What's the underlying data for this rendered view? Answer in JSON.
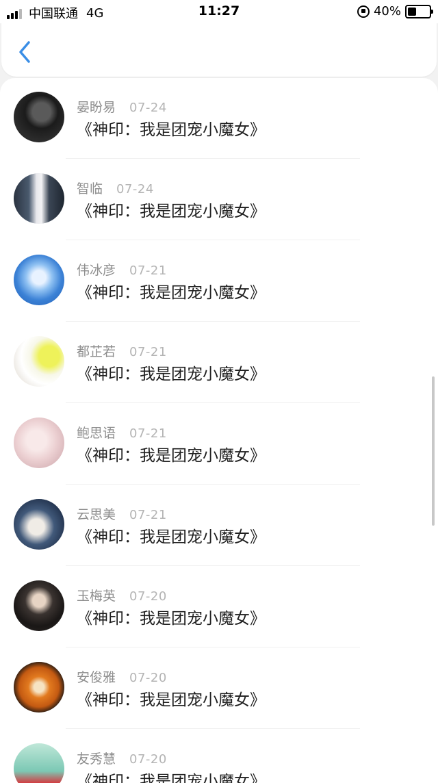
{
  "status_bar": {
    "carrier": "中国联通",
    "network": "4G",
    "time": "11:27",
    "battery": "40%",
    "battery_level": 0.4
  },
  "nav": {
    "back_icon": "chevron-left-icon",
    "accent_color": "#3a8ee6"
  },
  "colors": {
    "name": "#8e8e8e",
    "date": "#b4b4b4",
    "title": "#1f1f1f"
  },
  "items": [
    {
      "name": "晏盼易",
      "date": "07-24",
      "title": "《神印：我是团宠小魔女》"
    },
    {
      "name": "智临",
      "date": "07-24",
      "title": "《神印：我是团宠小魔女》"
    },
    {
      "name": "伟冰彦",
      "date": "07-21",
      "title": "《神印：我是团宠小魔女》"
    },
    {
      "name": "都芷若",
      "date": "07-21",
      "title": "《神印：我是团宠小魔女》"
    },
    {
      "name": "鲍思语",
      "date": "07-21",
      "title": "《神印：我是团宠小魔女》"
    },
    {
      "name": "云思美",
      "date": "07-21",
      "title": "《神印：我是团宠小魔女》"
    },
    {
      "name": "玉梅英",
      "date": "07-20",
      "title": "《神印：我是团宠小魔女》"
    },
    {
      "name": "安俊雅",
      "date": "07-20",
      "title": "《神印：我是团宠小魔女》"
    },
    {
      "name": "友秀慧",
      "date": "07-20",
      "title": "《神印：我是团宠小魔女》"
    }
  ]
}
